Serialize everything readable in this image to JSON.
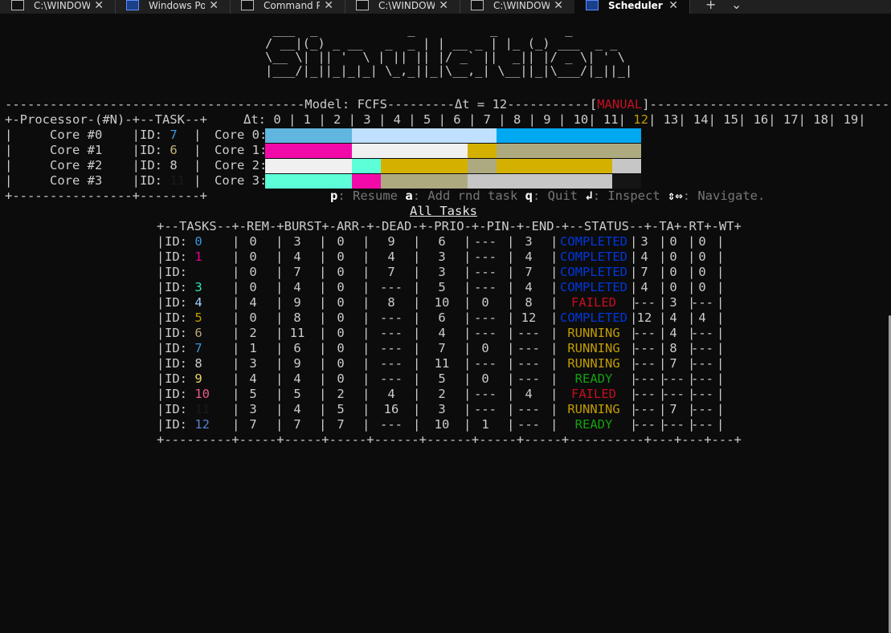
{
  "tabs": [
    {
      "label": "C:\\WINDOW",
      "icon": "cmd-icon"
    },
    {
      "label": "Windows Po",
      "icon": "powershell-icon"
    },
    {
      "label": "Command P",
      "icon": "cmd-icon"
    },
    {
      "label": "C:\\WINDOW",
      "icon": "cmd-icon"
    },
    {
      "label": "C:\\WINDOW",
      "icon": "cmd-icon"
    },
    {
      "label": "Scheduler Si",
      "icon": "powershell-icon",
      "active": true
    }
  ],
  "tab_close_glyph": "✕",
  "new_tab_glyph": "+",
  "dropdown_glyph": "⌄",
  "banner": [
    " ___  _            _          _         _ ",
    "/ __|(_) _ __   _  _ | | __ _ | |_ (_) ___  _ _ ",
    "\\__ \\| || '  \\ | || || |/ _` ||  _|| |/ _ \\| ' \\",
    "|___/|_||_|_|_| \\_,_||_|\\__,_| \\__||_|\\___/|_||_|"
  ],
  "model_line": {
    "prefix": "----------------------------------------Model: FCFS---------Δt = 12-----------[",
    "mode": "MANUAL",
    "suffix": "]--------------------------------"
  },
  "proc_header": "+-Processor-(#N)-+--TASK--+",
  "dt_line": {
    "prefix": "Δt: 0 | 1 | 2 | 3 | 4 | 5 | 6 | 7 | 8 | 9 | 10| 11| ",
    "current": "12",
    "suffix": "| 13| 14| 15| 16| 17| 18| 19|"
  },
  "cores": [
    {
      "name": "Core #0",
      "task_id": "7",
      "id_color": "#3a96dd",
      "timeline_label": "Core 0:"
    },
    {
      "name": "Core #1",
      "task_id": "6",
      "id_color": "#c2b27a",
      "timeline_label": "Core 1:"
    },
    {
      "name": "Core #2",
      "task_id": "8",
      "id_color": "#cccccc",
      "timeline_label": "Core 2:"
    },
    {
      "name": "Core #3",
      "task_id": "11",
      "id_color": "#1a1a1a",
      "timeline_label": "Core 3:"
    }
  ],
  "proc_footer": "+----------------+--------+",
  "timeline": [
    [
      {
        "color": "#61b6e0",
        "span": 3
      },
      {
        "color": "#bfe0ff",
        "span": 5
      },
      {
        "color": "#00a8f0",
        "span": 5
      }
    ],
    [
      {
        "color": "#f20aa8",
        "span": 3
      },
      {
        "color": "#f0f0f0",
        "span": 4
      },
      {
        "color": "#d4b000",
        "span": 1
      },
      {
        "color": "#aeaa80",
        "span": 5
      }
    ],
    [
      {
        "color": "#f0f0f0",
        "span": 3
      },
      {
        "color": "#5cffd8",
        "span": 1
      },
      {
        "color": "#d4b000",
        "span": 3
      },
      {
        "color": "#aeaa80",
        "span": 1
      },
      {
        "color": "#d4b000",
        "span": 4
      },
      {
        "color": "#c6c6c6",
        "span": 1
      }
    ],
    [
      {
        "color": "#5cffd8",
        "span": 3
      },
      {
        "color": "#f20aa8",
        "span": 1
      },
      {
        "color": "#aeaa80",
        "span": 3
      },
      {
        "color": "#c6c6c6",
        "span": 5
      },
      {
        "color": "#151515",
        "span": 1
      }
    ]
  ],
  "help": [
    {
      "key": "p",
      "text": ": Resume "
    },
    {
      "key": "a",
      "text": ": Add rnd task "
    },
    {
      "key": "q",
      "text": ": Quit "
    },
    {
      "key": "↲",
      "text": ": Inspect "
    },
    {
      "key": "⇕⇔",
      "text": ": Navigate."
    }
  ],
  "all_tasks_title": "All Tasks",
  "table_header": "+--TASKS--+-REM-+BURST+-ARR-+-DEAD-+-PRIO-+-PIN-+-END-+--STATUS--+-TA+-RT+-WT+",
  "table_footer": "+---------+-----+-----+-----+------+------+-----+-----+----------+---+---+---+",
  "tasks": [
    {
      "id": "0",
      "id_color": "#3a96dd",
      "rem": "0",
      "burst": "3",
      "arr": "0",
      "dead": "9",
      "prio": "6",
      "pin": "---",
      "end": "3",
      "status": "COMPLETED",
      "status_color": "#0037da",
      "ta": "3",
      "rt": "0",
      "wt": "0"
    },
    {
      "id": "1",
      "id_color": "#e3008c",
      "rem": "0",
      "burst": "4",
      "arr": "0",
      "dead": "4",
      "prio": "3",
      "pin": "---",
      "end": "4",
      "status": "COMPLETED",
      "status_color": "#0037da",
      "ta": "4",
      "rt": "0",
      "wt": "0"
    },
    {
      "id": "2",
      "id_color": "#0c0c0c",
      "rem": "0",
      "burst": "7",
      "arr": "0",
      "dead": "7",
      "prio": "3",
      "pin": "---",
      "end": "7",
      "status": "COMPLETED",
      "status_color": "#0037da",
      "ta": "7",
      "rt": "0",
      "wt": "0"
    },
    {
      "id": "3",
      "id_color": "#2ee6b8",
      "rem": "0",
      "burst": "4",
      "arr": "0",
      "dead": "---",
      "prio": "5",
      "pin": "---",
      "end": "4",
      "status": "COMPLETED",
      "status_color": "#0037da",
      "ta": "4",
      "rt": "0",
      "wt": "0"
    },
    {
      "id": "4",
      "id_color": "#9fd0ff",
      "rem": "4",
      "burst": "9",
      "arr": "0",
      "dead": "8",
      "prio": "10",
      "pin": "0",
      "end": "8",
      "status": "FAILED",
      "status_color": "#c50f1f",
      "ta": "---",
      "rt": "3",
      "wt": "---"
    },
    {
      "id": "5",
      "id_color": "#c19c00",
      "rem": "0",
      "burst": "8",
      "arr": "0",
      "dead": "---",
      "prio": "6",
      "pin": "---",
      "end": "12",
      "status": "COMPLETED",
      "status_color": "#0037da",
      "ta": "12",
      "rt": "4",
      "wt": "4"
    },
    {
      "id": "6",
      "id_color": "#b3a57a",
      "rem": "2",
      "burst": "11",
      "arr": "0",
      "dead": "---",
      "prio": "4",
      "pin": "---",
      "end": "---",
      "status": "RUNNING",
      "status_color": "#c19c00",
      "ta": "---",
      "rt": "4",
      "wt": "---"
    },
    {
      "id": "7",
      "id_color": "#3a96dd",
      "rem": "1",
      "burst": "6",
      "arr": "0",
      "dead": "---",
      "prio": "7",
      "pin": "0",
      "end": "---",
      "status": "RUNNING",
      "status_color": "#c19c00",
      "ta": "---",
      "rt": "8",
      "wt": "---"
    },
    {
      "id": "8",
      "id_color": "#cccccc",
      "rem": "3",
      "burst": "9",
      "arr": "0",
      "dead": "---",
      "prio": "11",
      "pin": "---",
      "end": "---",
      "status": "RUNNING",
      "status_color": "#c19c00",
      "ta": "---",
      "rt": "7",
      "wt": "---"
    },
    {
      "id": "9",
      "id_color": "#e8d66a",
      "rem": "4",
      "burst": "4",
      "arr": "0",
      "dead": "---",
      "prio": "5",
      "pin": "0",
      "end": "---",
      "status": "READY",
      "status_color": "#13a10e",
      "ta": "---",
      "rt": "---",
      "wt": "---"
    },
    {
      "id": "10",
      "id_color": "#e85a8a",
      "rem": "5",
      "burst": "5",
      "arr": "2",
      "dead": "4",
      "prio": "2",
      "pin": "---",
      "end": "4",
      "status": "FAILED",
      "status_color": "#c50f1f",
      "ta": "---",
      "rt": "---",
      "wt": "---"
    },
    {
      "id": "11",
      "id_color": "#1a1a1a",
      "rem": "3",
      "burst": "4",
      "arr": "5",
      "dead": "16",
      "prio": "3",
      "pin": "---",
      "end": "---",
      "status": "RUNNING",
      "status_color": "#c19c00",
      "ta": "---",
      "rt": "7",
      "wt": "---"
    },
    {
      "id": "12",
      "id_color": "#5a7fd6",
      "rem": "7",
      "burst": "7",
      "arr": "7",
      "dead": "---",
      "prio": "10",
      "pin": "1",
      "end": "---",
      "status": "READY",
      "status_color": "#13a10e",
      "ta": "---",
      "rt": "---",
      "wt": "---"
    }
  ]
}
